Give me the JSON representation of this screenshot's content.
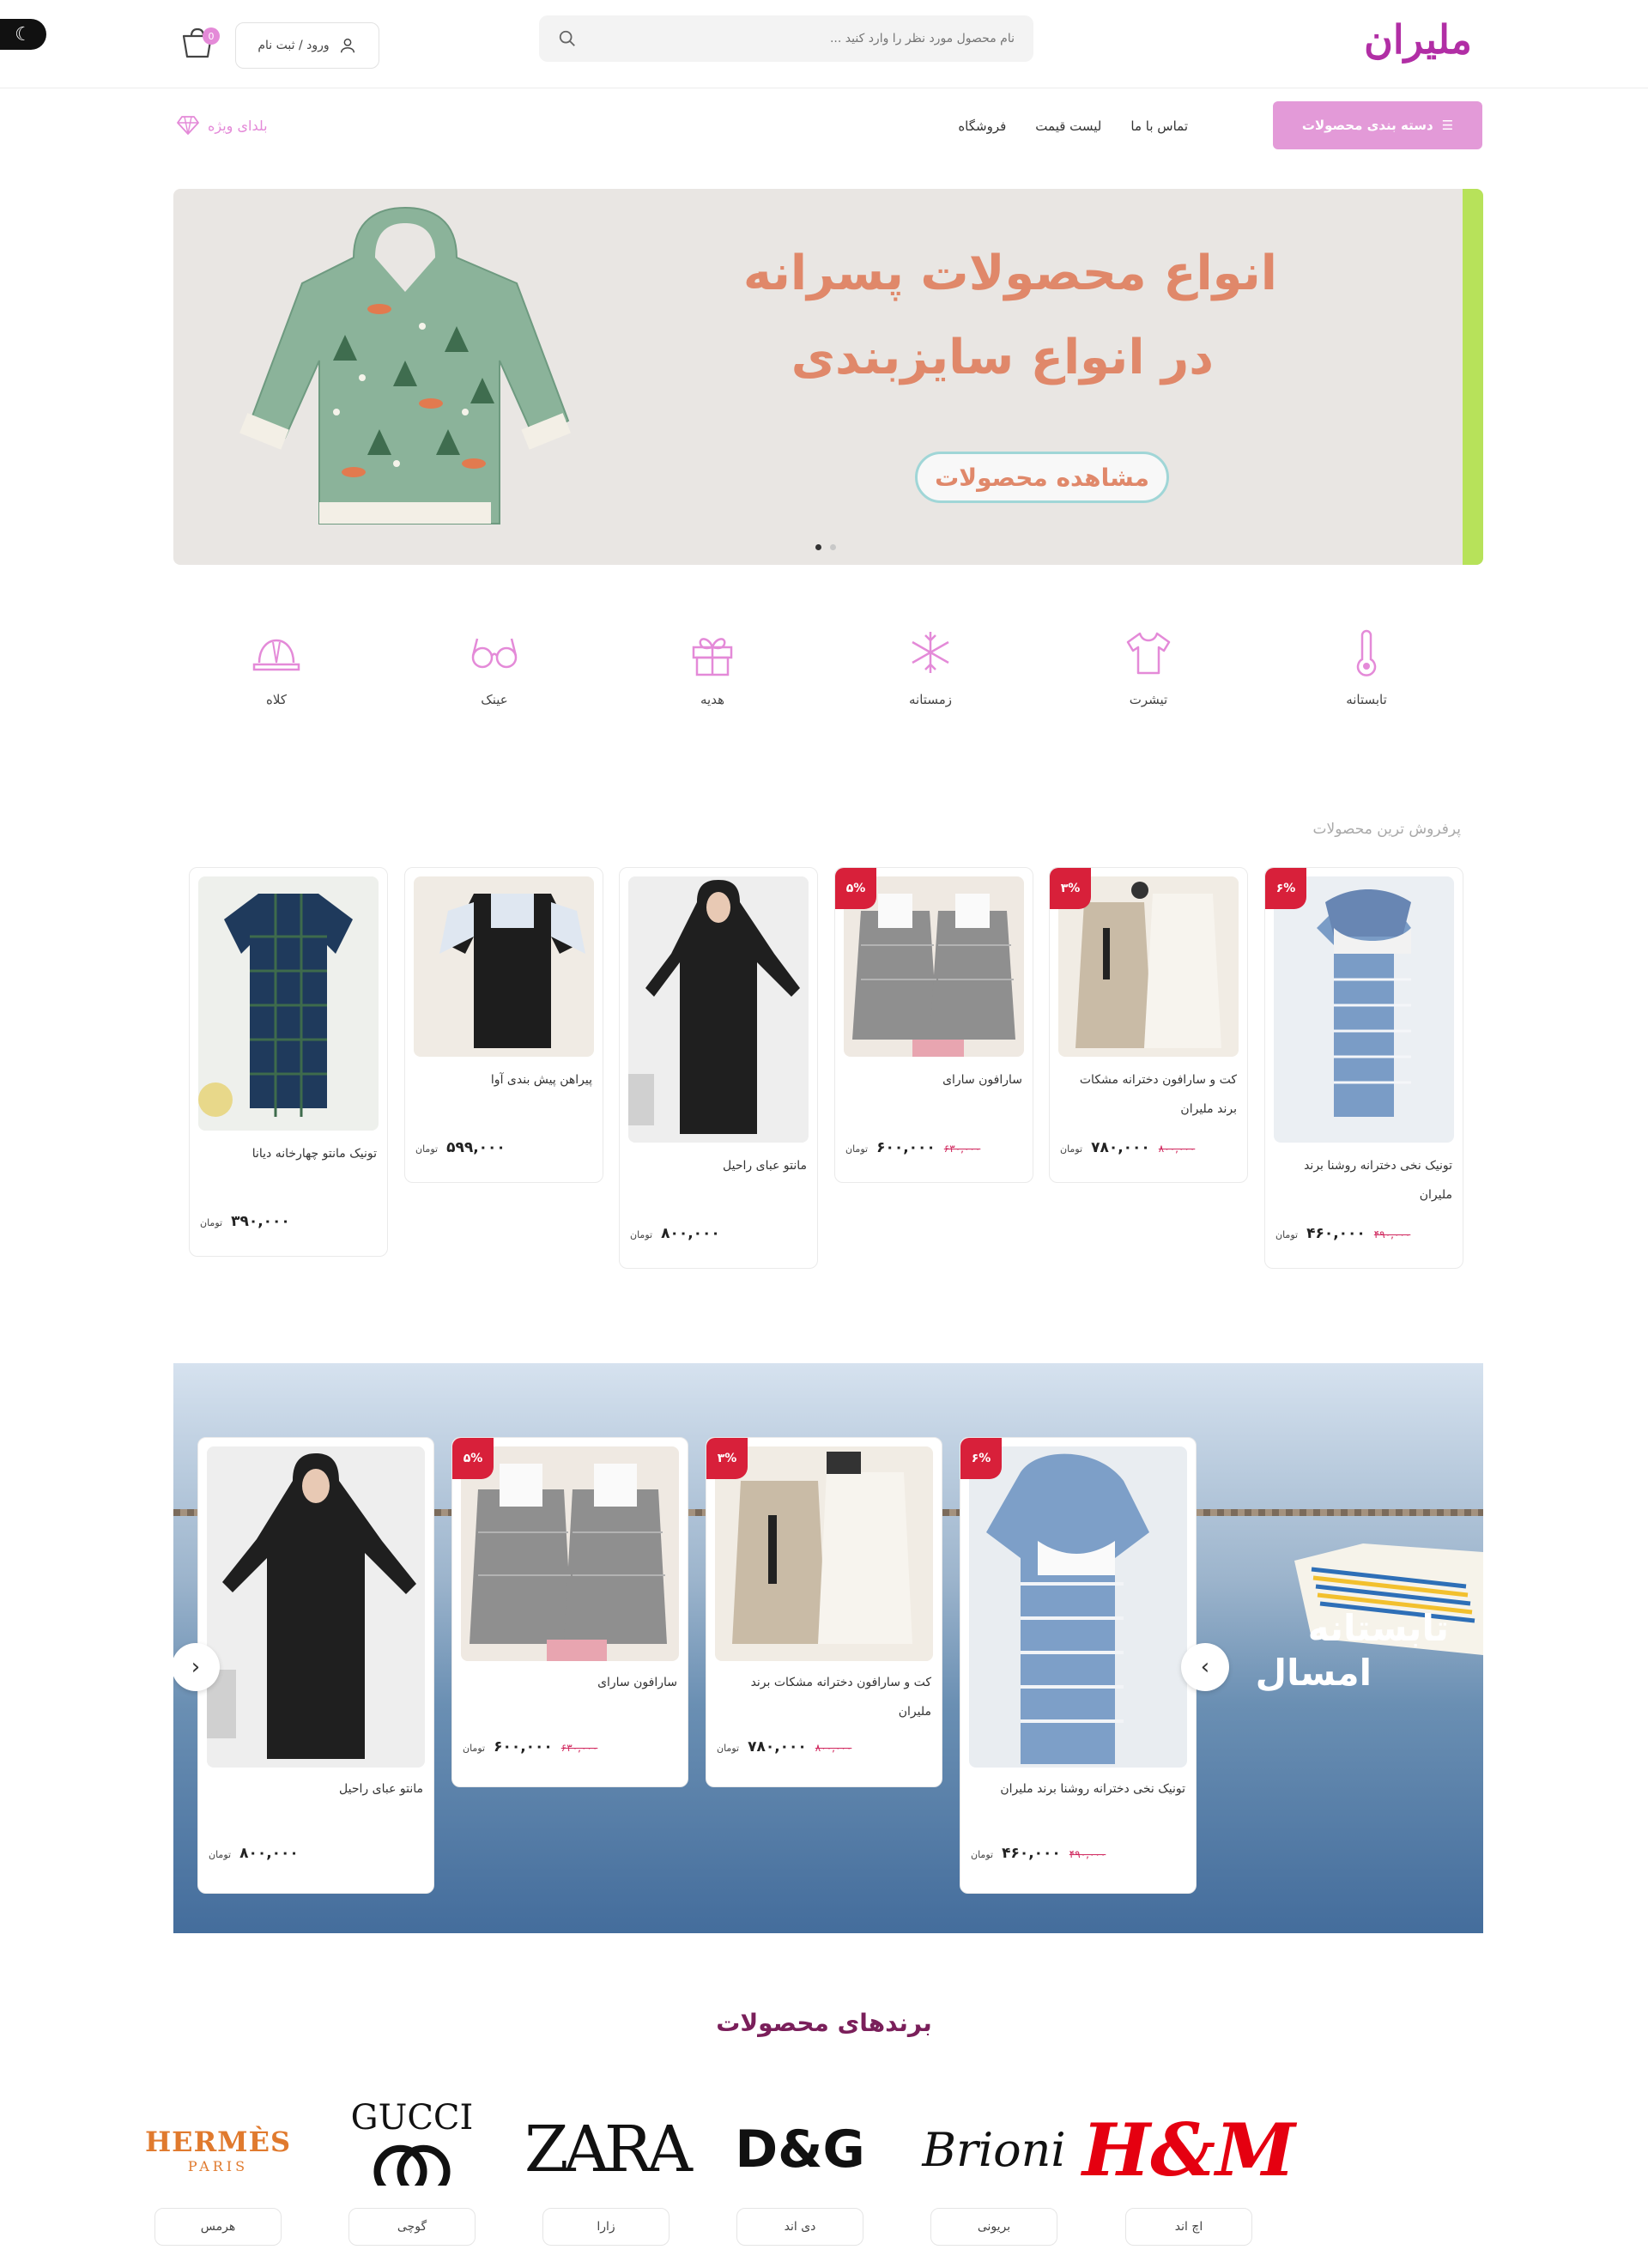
{
  "header": {
    "logo_text": "ملیران",
    "search_placeholder": "نام محصول مورد نظر را وارد کنید ...",
    "login_label": "ورود / ثبت نام",
    "cart_count": "0"
  },
  "nav": {
    "category_button": "دسته بندی محصولات",
    "links": [
      "تماس با ما",
      "لیست قیمت",
      "فروشگاه"
    ],
    "vip_label": "بلدای ویژه"
  },
  "hero": {
    "title_line1": "انواع محصولات پسرانه",
    "title_line2": "در انواع سایزبندی",
    "button_label": "مشاهده محصولات"
  },
  "categories": [
    "تابستانه",
    "تیشرت",
    "زمستانه",
    "هدیه",
    "عینک",
    "کلاه"
  ],
  "best_sellers": {
    "title": "پرفروش ترین محصولات",
    "currency": "تومان",
    "items": [
      {
        "name_line1": "تونیک نخی دخترانه روشنا برند",
        "name_line2": "ملیران",
        "price": "۴۶۰,۰۰۰",
        "old_price": "۴۹۰,۰۰۰",
        "discount": "۶%"
      },
      {
        "name_line1": "کت و سارافون دخترانه مشکات",
        "name_line2": "برند ملیران",
        "price": "۷۸۰,۰۰۰",
        "old_price": "۸۰۰,۰۰۰",
        "discount": "۳%"
      },
      {
        "name_line1": "سارافون سارای",
        "name_line2": "",
        "price": "۶۰۰,۰۰۰",
        "old_price": "۶۳۰,۰۰۰",
        "discount": "۵%"
      },
      {
        "name_line1": "مانتو عبای راحیل",
        "name_line2": "",
        "price": "۸۰۰,۰۰۰",
        "old_price": "",
        "discount": ""
      },
      {
        "name_line1": "پیراهن پیش بندی آوا",
        "name_line2": "",
        "price": "۵۹۹,۰۰۰",
        "old_price": "",
        "discount": ""
      },
      {
        "name_line1": "تونیک مانتو چهارخانه دیانا",
        "name_line2": "",
        "price": "۳۹۰,۰۰۰",
        "old_price": "",
        "discount": ""
      }
    ]
  },
  "promo_banner": {
    "text_line1": "تابستانه",
    "text_line2": "امسال",
    "items": [
      {
        "name_line1": "تونیک نخی دخترانه روشنا برند ملیران",
        "name_line2": "",
        "price": "۴۶۰,۰۰۰",
        "old_price": "۴۹۰,۰۰۰",
        "discount": "۶%"
      },
      {
        "name_line1": "کت و سارافون دخترانه مشکات برند",
        "name_line2": "ملیران",
        "price": "۷۸۰,۰۰۰",
        "old_price": "۸۰۰,۰۰۰",
        "discount": "۳%"
      },
      {
        "name_line1": "سارافون سارای",
        "name_line2": "",
        "price": "۶۰۰,۰۰۰",
        "old_price": "۶۳۰,۰۰۰",
        "discount": "۵%"
      },
      {
        "name_line1": "مانتو عبای راحیل",
        "name_line2": "",
        "price": "۸۰۰,۰۰۰",
        "old_price": "",
        "discount": ""
      }
    ]
  },
  "brands": {
    "title": "برندهای محصولات",
    "items": [
      {
        "logo_text": "H&M",
        "label": "اچ اند"
      },
      {
        "logo_text": "Brioni",
        "label": "بریونی"
      },
      {
        "logo_text": "D&G",
        "label": "دی اند"
      },
      {
        "logo_text": "ZARA",
        "label": "زارا"
      },
      {
        "logo_text": "GUCCI",
        "label": "گوچی"
      },
      {
        "logo_text": "HERMÈS",
        "logo_sub": "PARIS",
        "label": "هرمس"
      }
    ]
  },
  "colors": {
    "accent": "#e39ad8",
    "brand": "#b12ea5",
    "hero_text": "#e0886a",
    "discount": "#d8203a"
  }
}
